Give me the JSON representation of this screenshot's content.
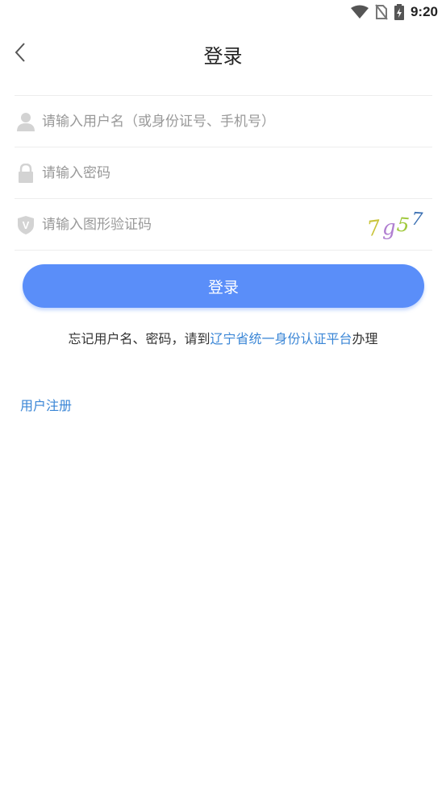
{
  "status_bar": {
    "time": "9:20"
  },
  "header": {
    "title": "登录"
  },
  "form": {
    "username_placeholder": "请输入用户名（或身份证号、手机号）",
    "password_placeholder": "请输入密码",
    "captcha_placeholder": "请输入图形验证码",
    "captcha_chars": [
      "7",
      "g",
      "5",
      "7"
    ]
  },
  "login_button": "登录",
  "forgot": {
    "prefix": "忘记用户名、密码，请到",
    "link": "辽宁省统一身份认证平台",
    "suffix": "办理"
  },
  "register_link": "用户注册",
  "colors": {
    "primary": "#5a8ef9",
    "link": "#3a86d6"
  }
}
